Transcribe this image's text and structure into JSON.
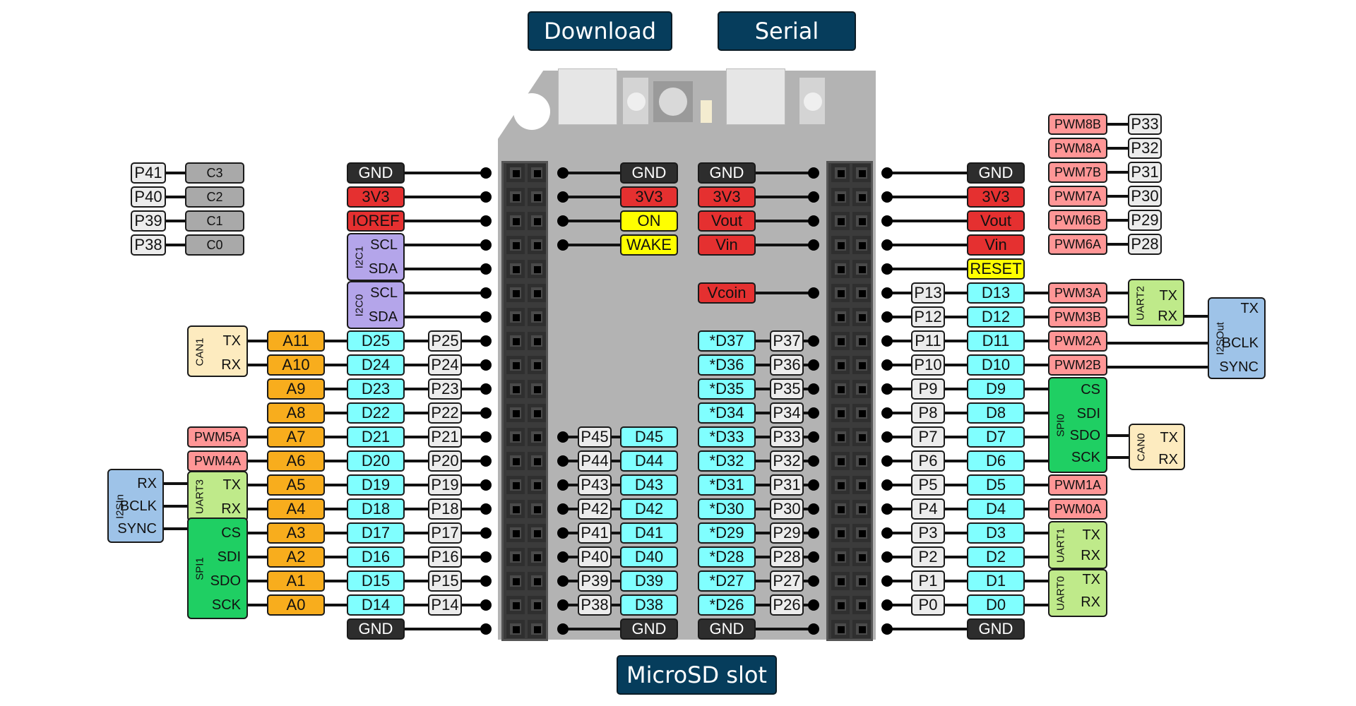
{
  "colors": {
    "gnd": "#2d2d2d",
    "power": "#e53030",
    "control": "#ffff00",
    "digital": "#80ffff",
    "analog": "#f8ad1d",
    "port": "#ececec",
    "pwm": "#ff9696",
    "i2c": "#b4a5ea",
    "spi": "#1fcf63",
    "uart": "#bfea8a",
    "can": "#fdebbf",
    "i2s": "#9ec3e8",
    "cap": "#a9a9a9",
    "nav": "#063d5c"
  },
  "buttons": {
    "download": "Download",
    "serial": "Serial",
    "microsd": "MicroSD slot"
  },
  "left_outer": {
    "top": [
      {
        "row": 0,
        "label": "GND",
        "type": "gnd"
      },
      {
        "row": 1,
        "label": "3V3",
        "type": "power"
      },
      {
        "row": 2,
        "label": "IOREF",
        "type": "power"
      }
    ],
    "i2c": [
      {
        "name": "I2C1",
        "rows": [
          3,
          4
        ],
        "signals": [
          "SCL",
          "SDA"
        ]
      },
      {
        "name": "I2C0",
        "rows": [
          5,
          6
        ],
        "signals": [
          "SCL",
          "SDA"
        ]
      }
    ],
    "digital": [
      {
        "row": 7,
        "d": "D25",
        "p": "P25",
        "a": "A11"
      },
      {
        "row": 8,
        "d": "D24",
        "p": "P24",
        "a": "A10"
      },
      {
        "row": 9,
        "d": "D23",
        "p": "P23",
        "a": "A9"
      },
      {
        "row": 10,
        "d": "D22",
        "p": "P22",
        "a": "A8"
      },
      {
        "row": 11,
        "d": "D21",
        "p": "P21",
        "a": "A7"
      },
      {
        "row": 12,
        "d": "D20",
        "p": "P20",
        "a": "A6"
      },
      {
        "row": 13,
        "d": "D19",
        "p": "P19",
        "a": "A5"
      },
      {
        "row": 14,
        "d": "D18",
        "p": "P18",
        "a": "A4"
      },
      {
        "row": 15,
        "d": "D17",
        "p": "P17",
        "a": "A3"
      },
      {
        "row": 16,
        "d": "D16",
        "p": "P16",
        "a": "A2"
      },
      {
        "row": 17,
        "d": "D15",
        "p": "P15",
        "a": "A1"
      },
      {
        "row": 18,
        "d": "D14",
        "p": "P14",
        "a": "A0"
      }
    ],
    "bottom": [
      {
        "row": 19,
        "label": "GND",
        "type": "gnd"
      }
    ],
    "pwm": [
      {
        "row": 11,
        "label": "PWM5A"
      },
      {
        "row": 12,
        "label": "PWM4A"
      }
    ],
    "can1": {
      "name": "CAN1",
      "rows": [
        7,
        8
      ],
      "signals": [
        "TX",
        "RX"
      ]
    },
    "uart3": {
      "name": "UART3",
      "rows": [
        13,
        14
      ],
      "signals": [
        "TX",
        "RX"
      ]
    },
    "spi1": {
      "name": "SPI1",
      "rows": [
        15,
        18
      ],
      "signals": [
        "CS",
        "SDI",
        "SDO",
        "SCK"
      ]
    },
    "i2sin": {
      "name": "I2SIn",
      "signals": [
        "RX",
        "BCLK",
        "SYNC"
      ]
    },
    "cap": [
      {
        "p": "P41",
        "c": "C3"
      },
      {
        "p": "P40",
        "c": "C2"
      },
      {
        "p": "P39",
        "c": "C1"
      },
      {
        "p": "P38",
        "c": "C0"
      }
    ]
  },
  "inner_left": {
    "top": [
      {
        "row": 0,
        "label": "GND",
        "type": "gnd"
      },
      {
        "row": 1,
        "label": "3V3",
        "type": "power"
      },
      {
        "row": 2,
        "label": "ON",
        "type": "control"
      },
      {
        "row": 3,
        "label": "WAKE",
        "type": "control"
      }
    ],
    "digital": [
      {
        "row": 11,
        "d": "D45",
        "p": "P45"
      },
      {
        "row": 12,
        "d": "D44",
        "p": "P44"
      },
      {
        "row": 13,
        "d": "D43",
        "p": "P43"
      },
      {
        "row": 14,
        "d": "D42",
        "p": "P42"
      },
      {
        "row": 15,
        "d": "D41",
        "p": "P41"
      },
      {
        "row": 16,
        "d": "D40",
        "p": "P40"
      },
      {
        "row": 17,
        "d": "D39",
        "p": "P39"
      },
      {
        "row": 18,
        "d": "D38",
        "p": "P38"
      }
    ],
    "bottom": [
      {
        "row": 19,
        "label": "GND",
        "type": "gnd"
      }
    ]
  },
  "inner_right": {
    "top": [
      {
        "row": 0,
        "label": "GND",
        "type": "gnd"
      },
      {
        "row": 1,
        "label": "3V3",
        "type": "power"
      },
      {
        "row": 2,
        "label": "Vout",
        "type": "power"
      },
      {
        "row": 3,
        "label": "Vin",
        "type": "power"
      },
      {
        "row": 5,
        "label": "Vcoin",
        "type": "power"
      }
    ],
    "digital": [
      {
        "row": 7,
        "d": "*D37",
        "p": "P37"
      },
      {
        "row": 8,
        "d": "*D36",
        "p": "P36"
      },
      {
        "row": 9,
        "d": "*D35",
        "p": "P35"
      },
      {
        "row": 10,
        "d": "*D34",
        "p": "P34"
      },
      {
        "row": 11,
        "d": "*D33",
        "p": "P33"
      },
      {
        "row": 12,
        "d": "*D32",
        "p": "P32"
      },
      {
        "row": 13,
        "d": "*D31",
        "p": "P31"
      },
      {
        "row": 14,
        "d": "*D30",
        "p": "P30"
      },
      {
        "row": 15,
        "d": "*D29",
        "p": "P29"
      },
      {
        "row": 16,
        "d": "*D28",
        "p": "P28"
      },
      {
        "row": 17,
        "d": "*D27",
        "p": "P27"
      },
      {
        "row": 18,
        "d": "*D26",
        "p": "P26"
      }
    ],
    "bottom": [
      {
        "row": 19,
        "label": "GND",
        "type": "gnd"
      }
    ]
  },
  "right_outer": {
    "top": [
      {
        "row": 0,
        "label": "GND",
        "type": "gnd"
      },
      {
        "row": 1,
        "label": "3V3",
        "type": "power"
      },
      {
        "row": 2,
        "label": "Vout",
        "type": "power"
      },
      {
        "row": 3,
        "label": "Vin",
        "type": "power"
      },
      {
        "row": 4,
        "label": "RESET",
        "type": "control"
      }
    ],
    "digital": [
      {
        "row": 5,
        "d": "D13",
        "p": "P13"
      },
      {
        "row": 6,
        "d": "D12",
        "p": "P12"
      },
      {
        "row": 7,
        "d": "D11",
        "p": "P11"
      },
      {
        "row": 8,
        "d": "D10",
        "p": "P10"
      },
      {
        "row": 9,
        "d": "D9",
        "p": "P9"
      },
      {
        "row": 10,
        "d": "D8",
        "p": "P8"
      },
      {
        "row": 11,
        "d": "D7",
        "p": "P7"
      },
      {
        "row": 12,
        "d": "D6",
        "p": "P6"
      },
      {
        "row": 13,
        "d": "D5",
        "p": "P5"
      },
      {
        "row": 14,
        "d": "D4",
        "p": "P4"
      },
      {
        "row": 15,
        "d": "D3",
        "p": "P3"
      },
      {
        "row": 16,
        "d": "D2",
        "p": "P2"
      },
      {
        "row": 17,
        "d": "D1",
        "p": "P1"
      },
      {
        "row": 18,
        "d": "D0",
        "p": "P0"
      }
    ],
    "bottom": [
      {
        "row": 19,
        "label": "GND",
        "type": "gnd"
      }
    ],
    "pwm": [
      {
        "row": 5,
        "label": "PWM3A"
      },
      {
        "row": 6,
        "label": "PWM3B"
      },
      {
        "row": 7,
        "label": "PWM2A"
      },
      {
        "row": 8,
        "label": "PWM2B"
      },
      {
        "row": 13,
        "label": "PWM1A"
      },
      {
        "row": 14,
        "label": "PWM0A"
      }
    ],
    "spi0": {
      "name": "SPI0",
      "rows": [
        9,
        12
      ],
      "signals": [
        "CS",
        "SDI",
        "SDO",
        "SCK"
      ]
    },
    "uart1": {
      "name": "UART1",
      "rows": [
        15,
        16
      ],
      "signals": [
        "TX",
        "RX"
      ]
    },
    "uart0": {
      "name": "UART0",
      "rows": [
        17,
        18
      ],
      "signals": [
        "TX",
        "RX"
      ]
    },
    "uart2": {
      "name": "UART2",
      "signals": [
        "TX",
        "RX"
      ]
    },
    "i2sout": {
      "name": "I2SOut",
      "signals": [
        "TX",
        "BCLK",
        "SYNC"
      ]
    },
    "can0": {
      "name": "CAN0",
      "signals": [
        "TX",
        "RX"
      ]
    },
    "pwm_top": [
      {
        "pwm": "PWM8B",
        "p": "P33"
      },
      {
        "pwm": "PWM8A",
        "p": "P32"
      },
      {
        "pwm": "PWM7B",
        "p": "P31"
      },
      {
        "pwm": "PWM7A",
        "p": "P30"
      },
      {
        "pwm": "PWM6B",
        "p": "P29"
      },
      {
        "pwm": "PWM6A",
        "p": "P28"
      }
    ]
  }
}
